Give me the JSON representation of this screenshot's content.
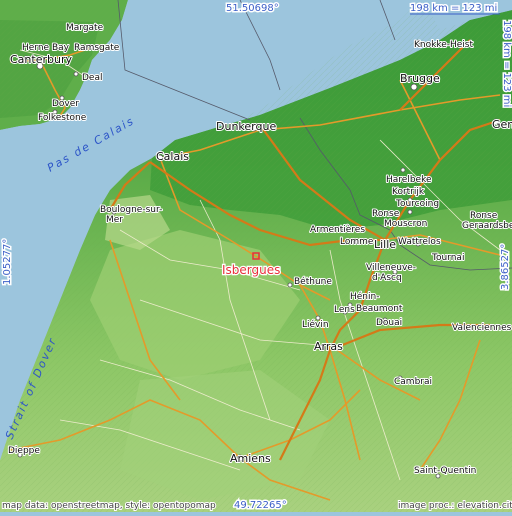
{
  "map": {
    "highlight_place": "Isbergues",
    "colors": {
      "sea": "#9cc5dd",
      "land_low": "#3f9e3a",
      "land_mid": "#7fbf5a",
      "land_high": "#b8d98c",
      "highlight": "#e8303a",
      "road": "#e49a2a"
    },
    "cities": [
      {
        "id": "isbergues",
        "name": "Isbergues"
      },
      {
        "id": "herne-bay",
        "name": "Herne Bay"
      },
      {
        "id": "margate",
        "name": "Margate"
      },
      {
        "id": "ramsgate",
        "name": "Ramsgate"
      },
      {
        "id": "canterbury",
        "name": "Canterbury"
      },
      {
        "id": "deal",
        "name": "Deal"
      },
      {
        "id": "dover",
        "name": "Dover"
      },
      {
        "id": "folkestone",
        "name": "Folkestone"
      },
      {
        "id": "knokke-heist",
        "name": "Knokke-Heist"
      },
      {
        "id": "brugge",
        "name": "Brugge"
      },
      {
        "id": "gent",
        "name": "Gent"
      },
      {
        "id": "dunkerque",
        "name": "Dunkerque"
      },
      {
        "id": "calais",
        "name": "Calais"
      },
      {
        "id": "harelbeke",
        "name": "Harelbeke"
      },
      {
        "id": "kortrijk",
        "name": "Kortrijk"
      },
      {
        "id": "roubaix",
        "name": "Roubaix"
      },
      {
        "id": "tourcoing",
        "name": "Tourcoing"
      },
      {
        "id": "mouscron",
        "name": "Mouscron"
      },
      {
        "id": "ronse",
        "name": "Ronse"
      },
      {
        "id": "geraardsbergen",
        "name": "Geraardsbergen"
      },
      {
        "id": "boulogne",
        "name": "Boulogne-sur-\nMer"
      },
      {
        "id": "armentieres",
        "name": "Armentières"
      },
      {
        "id": "lomme",
        "name": "Lomme"
      },
      {
        "id": "lille",
        "name": "Lille"
      },
      {
        "id": "wattrelos",
        "name": "Wattrelos"
      },
      {
        "id": "tournai",
        "name": "Tournai"
      },
      {
        "id": "villeneuve",
        "name": "Villeneuve-\nd'Ascq"
      },
      {
        "id": "bethune",
        "name": "Béthune"
      },
      {
        "id": "henin",
        "name": "Hénin-\nBeaumont"
      },
      {
        "id": "lens",
        "name": "Lens"
      },
      {
        "id": "douai",
        "name": "Douai"
      },
      {
        "id": "lievin",
        "name": "Liévin"
      },
      {
        "id": "valenciennes",
        "name": "Valenciennes"
      },
      {
        "id": "arras",
        "name": "Arras"
      },
      {
        "id": "cambrai",
        "name": "Cambrai"
      },
      {
        "id": "dieppe",
        "name": "Dieppe"
      },
      {
        "id": "amiens",
        "name": "Amiens"
      },
      {
        "id": "saint-quentin",
        "name": "Saint-Quentin"
      }
    ],
    "sea_labels": {
      "pas_de_calais": "Pas de Calais",
      "strait_of_dover": "Strait of Dover"
    },
    "coordinates": {
      "top": "51.50698°",
      "bottom": "49.72265°",
      "left": "1.05277°",
      "right": "3.86527°"
    },
    "scale": {
      "horizontal": "198 km = 123 mi",
      "vertical": "198 km = 123 mi"
    },
    "attribution": {
      "left": "map data: openstreetmap, style: opentopomap",
      "right": "image proc.: elevation.city"
    }
  }
}
